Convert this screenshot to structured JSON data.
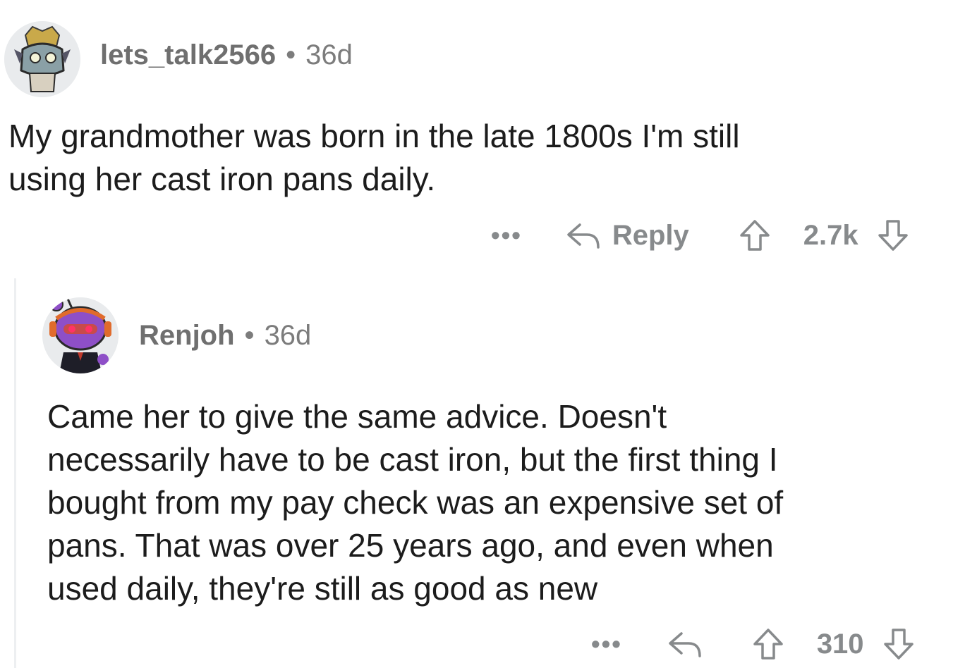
{
  "comments": [
    {
      "username": "lets_talk2566",
      "separator": "•",
      "age": "36d",
      "text_lines": [
        "My grandmother was born in the late 1800s I'm still",
        "using her cast iron pans daily."
      ],
      "more_label": "•••",
      "reply_label": "Reply",
      "score": "2.7k"
    },
    {
      "username": "Renjoh",
      "separator": "•",
      "age": "36d",
      "text_lines": [
        "Came her to give the same advice. Doesn't",
        "necessarily have to be cast iron, but the first thing I",
        "bought from my pay check was an expensive set of",
        "pans. That was over 25 years ago, and even when",
        "used daily, they're still as good as new"
      ],
      "more_label": "•••",
      "score": "310"
    }
  ],
  "colors": {
    "meta": "#7c7c7c",
    "text": "#1c1c1c",
    "action": "#878a8c",
    "thread_line": "#edeff1"
  }
}
